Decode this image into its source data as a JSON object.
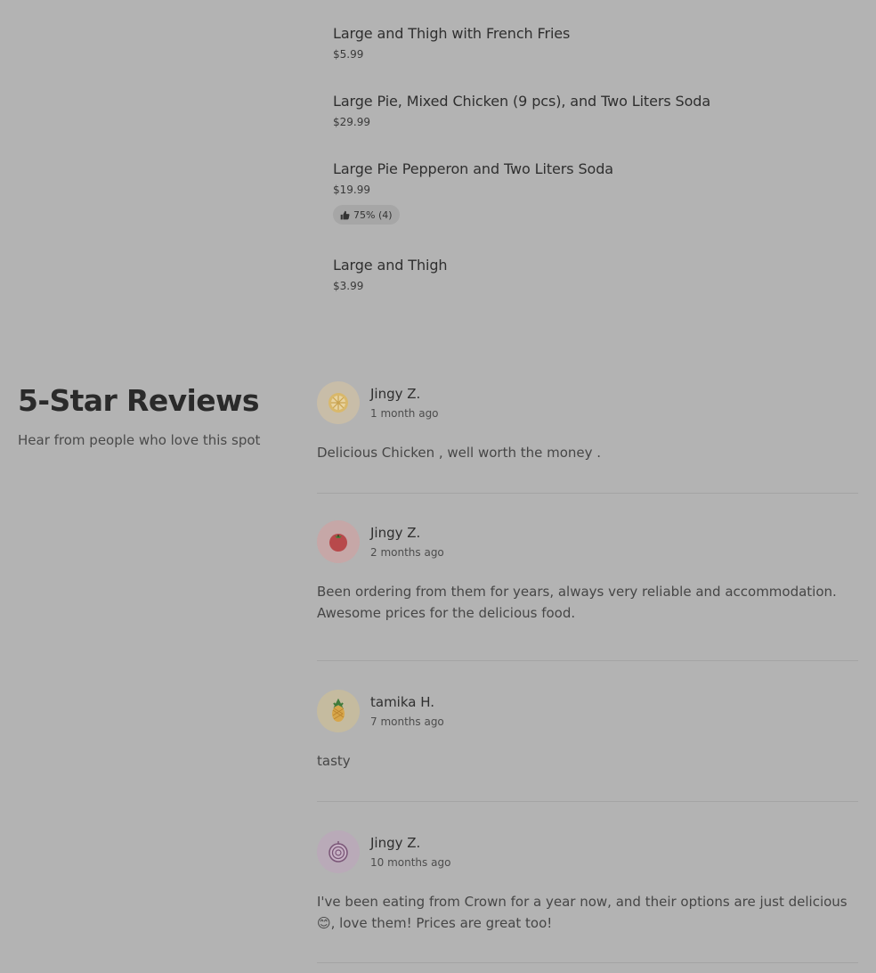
{
  "menu": {
    "items": [
      {
        "name": "Large and Thigh with French Fries",
        "price": "$5.99"
      },
      {
        "name": "Large Pie, Mixed Chicken (9 pcs), and Two Liters Soda",
        "price": "$29.99"
      },
      {
        "name": "Large Pie Pepperon and Two Liters Soda",
        "price": "$19.99",
        "rating": "75% (4)",
        "rating_icon": "thumbs-up-icon"
      },
      {
        "name": "Large and Thigh",
        "price": "$3.99"
      }
    ]
  },
  "reviews_section": {
    "title": "5-Star Reviews",
    "subtitle": "Hear from people who love this spot"
  },
  "reviews": [
    {
      "name": "Jingy Z.",
      "date": "1 month ago",
      "text": "Delicious Chicken , well worth the money .",
      "avatar_icon": "lemon-icon",
      "avatar_color": "#c8bda8"
    },
    {
      "name": "Jingy Z.",
      "date": "2 months ago",
      "text": "Been ordering from them for years, always very reliable and accommodation. Awesome prices for the delicious food.",
      "avatar_icon": "tomato-icon",
      "avatar_color": "#c6a7a7"
    },
    {
      "name": "tamika H.",
      "date": "7 months ago",
      "text": "tasty",
      "avatar_icon": "pineapple-icon",
      "avatar_color": "#c5bb9f"
    },
    {
      "name": "Jingy Z.",
      "date": "10 months ago",
      "text": "I've been eating from Crown for a year now, and their options are just delicious 😊, love them! Prices are great too!",
      "avatar_icon": "onion-icon",
      "avatar_color": "#b9aab8"
    }
  ]
}
